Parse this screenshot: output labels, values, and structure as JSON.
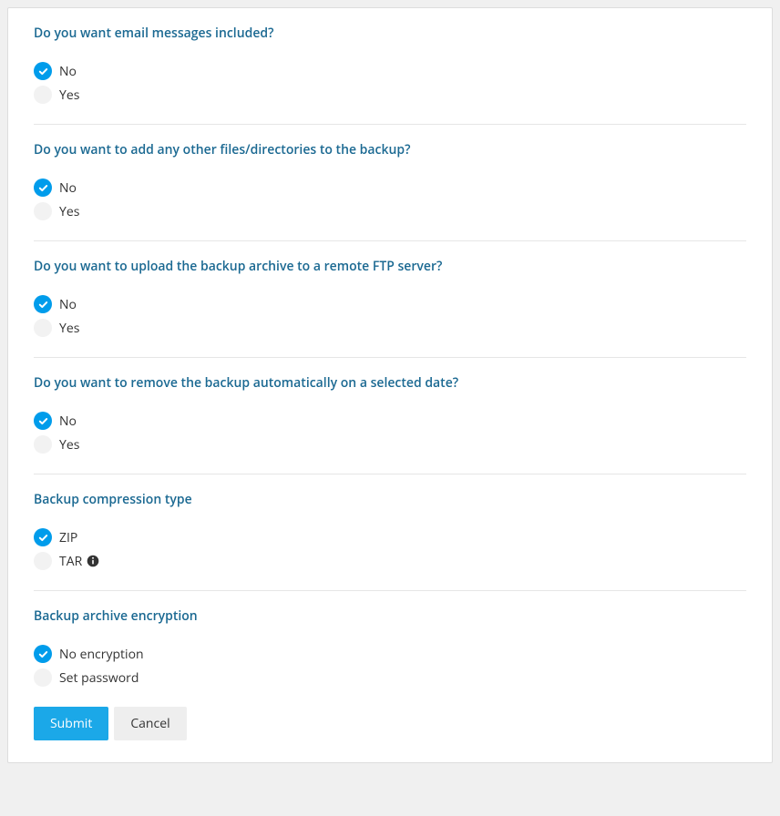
{
  "sections": {
    "email": {
      "title": "Do you want email messages included?",
      "option_no": "No",
      "option_yes": "Yes"
    },
    "files": {
      "title": "Do you want to add any other files/directories to the backup?",
      "option_no": "No",
      "option_yes": "Yes"
    },
    "ftp": {
      "title": "Do you want to upload the backup archive to a remote FTP server?",
      "option_no": "No",
      "option_yes": "Yes"
    },
    "autoremove": {
      "title": "Do you want to remove the backup automatically on a selected date?",
      "option_no": "No",
      "option_yes": "Yes"
    },
    "compression": {
      "title": "Backup compression type",
      "option_zip": "ZIP",
      "option_tar": "TAR"
    },
    "encryption": {
      "title": "Backup archive encryption",
      "option_none": "No encryption",
      "option_password": "Set password"
    }
  },
  "buttons": {
    "submit": "Submit",
    "cancel": "Cancel"
  }
}
